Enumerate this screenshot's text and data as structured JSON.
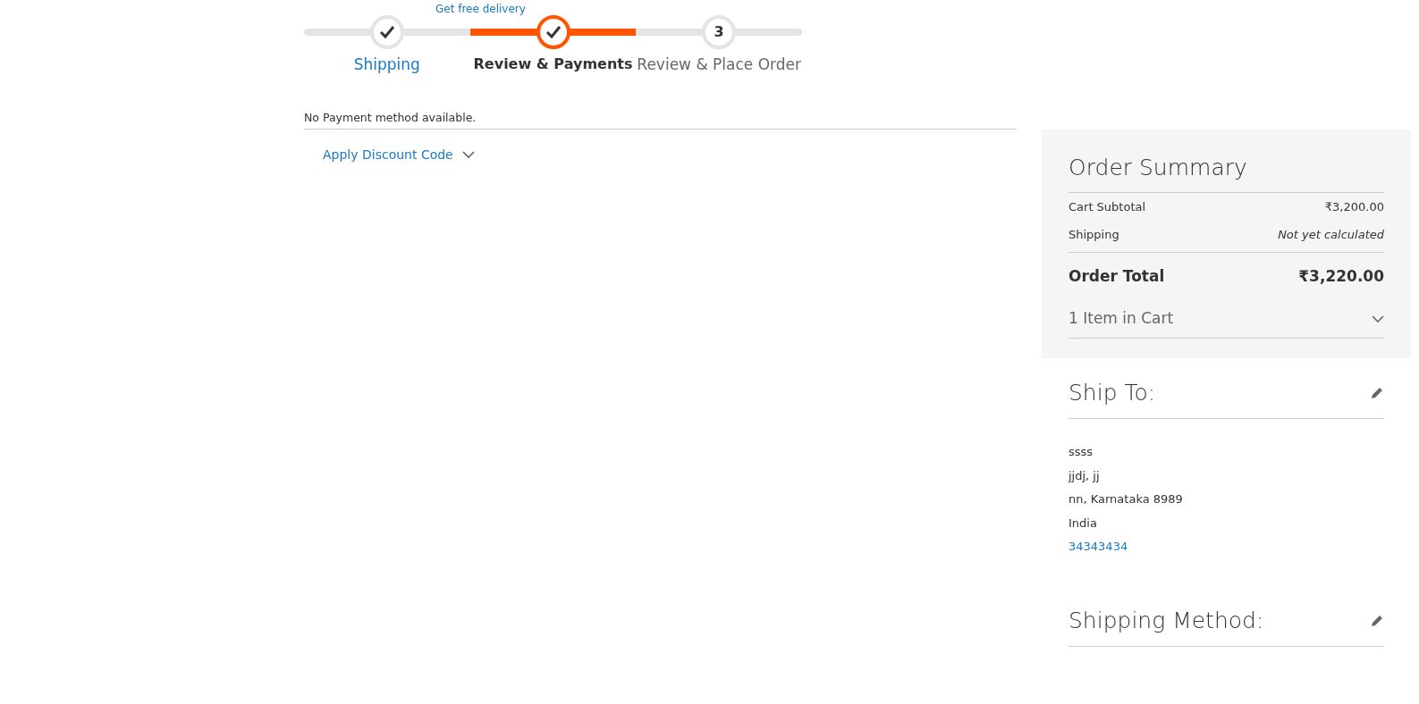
{
  "promo_link": "Get free delivery",
  "progress_steps": [
    {
      "label": "Shipping",
      "selected": false,
      "completed": true
    },
    {
      "label": "Review & Payments",
      "selected": true,
      "completed": true
    },
    {
      "label": "Review & Place Order",
      "selected": false,
      "completed": false,
      "number": "3"
    }
  ],
  "payment_message": "No Payment method available.",
  "discount": {
    "label": "Apply Discount Code",
    "expanded": false
  },
  "order_summary": {
    "title": "Order Summary",
    "rows": [
      {
        "label": "Cart Subtotal",
        "value": "₹3,200.00",
        "kind": "plain"
      },
      {
        "label": "Shipping",
        "value": "Not yet calculated",
        "kind": "note"
      },
      {
        "label": "Order Total",
        "value": "₹3,220.00",
        "kind": "total"
      }
    ],
    "items_toggle": {
      "label": "1 Item in Cart",
      "expanded": false
    }
  },
  "ship_to": {
    "title": "Ship To:",
    "lines": [
      "ssss",
      "jjdj, jj",
      "nn, Karnataka 8989",
      "India"
    ],
    "phone": "34343434"
  },
  "shipping_method": {
    "title": "Shipping Method:"
  }
}
